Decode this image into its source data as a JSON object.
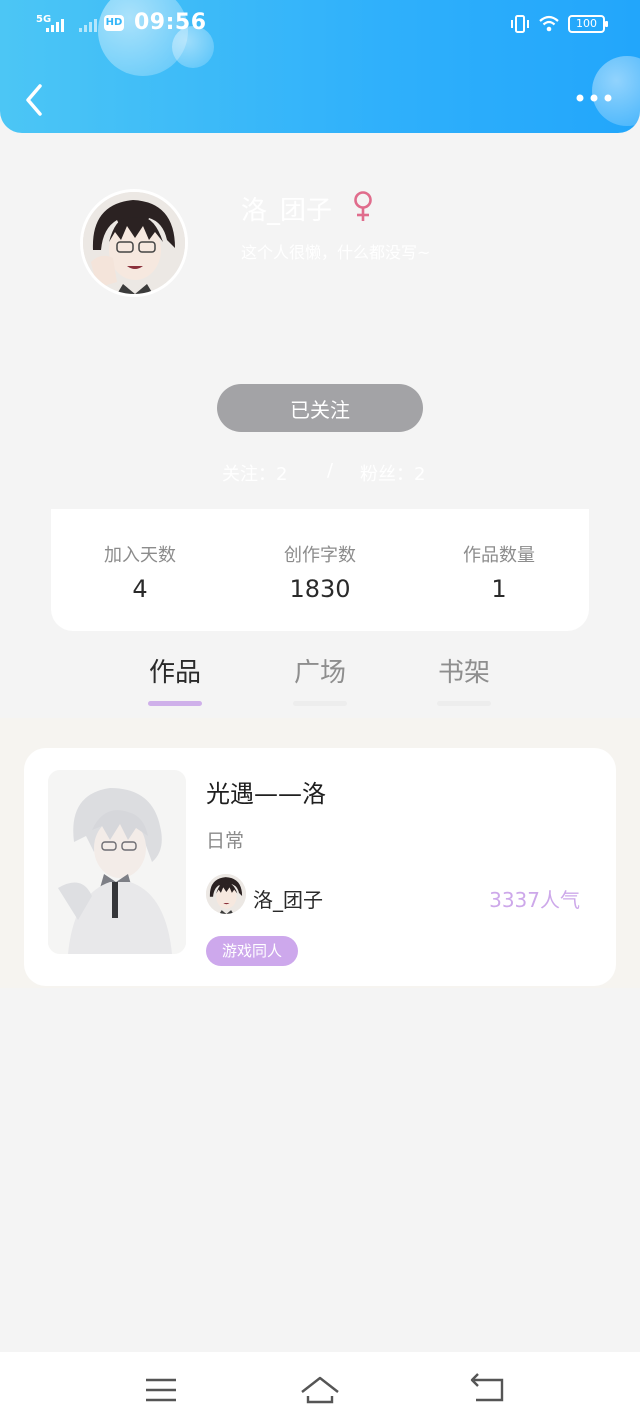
{
  "status_bar": {
    "network": "5G",
    "hd": "HD",
    "time": "09:56",
    "battery": "100"
  },
  "header": {
    "back_icon": "chevron-left-icon",
    "more_icon": "more-horizontal-icon"
  },
  "profile": {
    "username": "洛_团子",
    "gender_icon": "female-icon",
    "bio": "这个人很懒，什么都没写~",
    "follow_button_label": "已关注",
    "following": "关注：2",
    "separator": "/",
    "fans": "粉丝：2"
  },
  "stats": [
    {
      "label": "加入天数",
      "value": "4"
    },
    {
      "label": "创作字数",
      "value": "1830"
    },
    {
      "label": "作品数量",
      "value": "1"
    }
  ],
  "tabs": [
    {
      "label": "作品",
      "active": true
    },
    {
      "label": "广场",
      "active": false
    },
    {
      "label": "书架",
      "active": false
    }
  ],
  "works": [
    {
      "title": "光遇——洛",
      "category": "日常",
      "author": "洛_团子",
      "popularity": "3337人气",
      "tag": "游戏同人"
    }
  ],
  "bottom_nav": {
    "menu_icon": "menu-icon",
    "home_icon": "home-icon",
    "back_icon": "return-icon"
  },
  "colors": {
    "header_gradient_start": "#4cc6f5",
    "header_gradient_end": "#22a6fb",
    "accent_purple": "#cda8ea",
    "follow_button": "#a3a3a6",
    "female_icon": "#e06c8c"
  }
}
